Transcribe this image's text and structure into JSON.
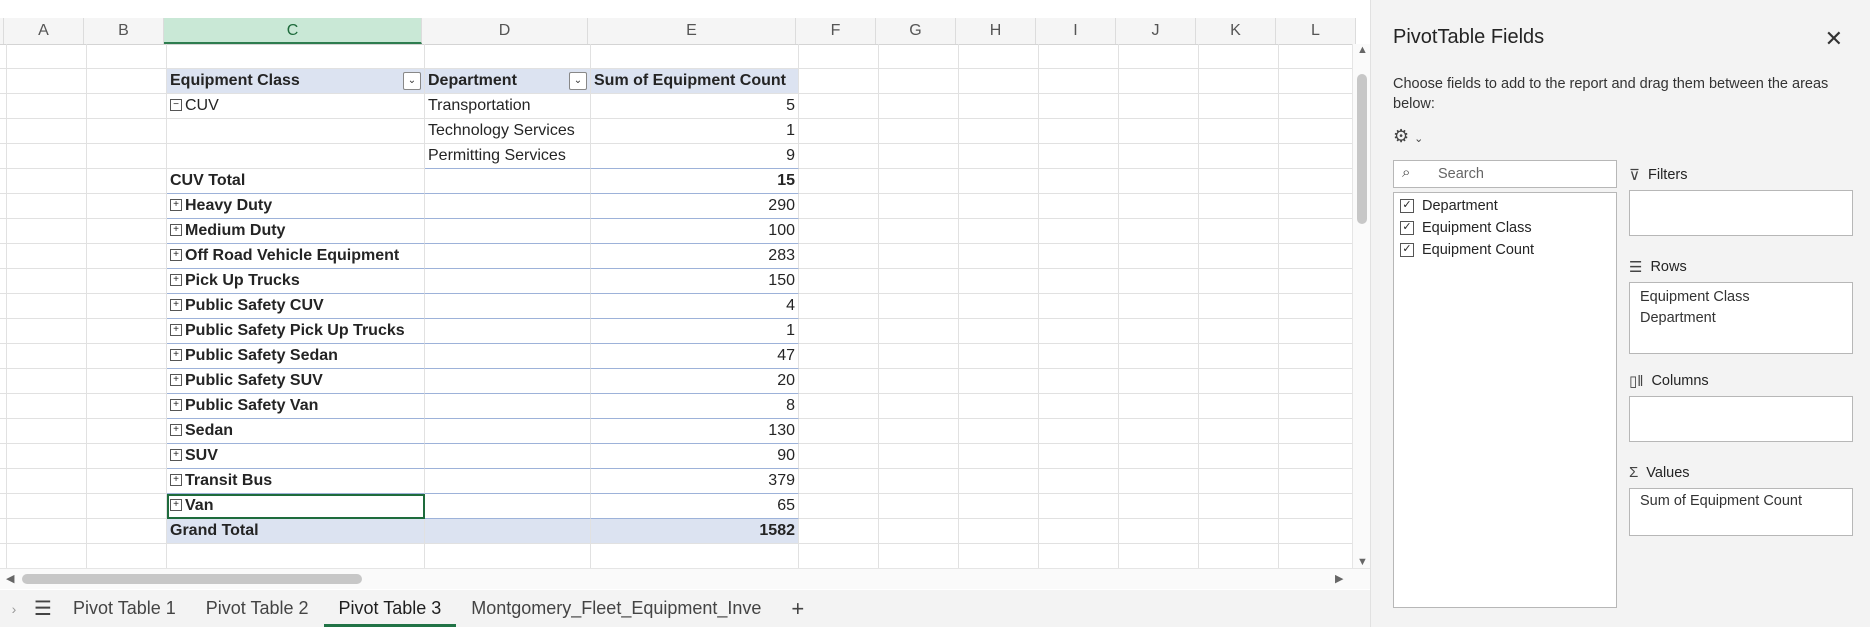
{
  "columns": [
    "A",
    "B",
    "C",
    "D",
    "E",
    "F",
    "G",
    "H",
    "I",
    "J",
    "K",
    "L"
  ],
  "selected_column": "C",
  "pivot": {
    "header": {
      "class": "Equipment Class",
      "dept": "Department",
      "sum": "Sum of Equipment Count"
    },
    "cuv": {
      "label": "CUV",
      "sub": [
        {
          "dept": "Transportation",
          "value": "5"
        },
        {
          "dept": "Technology Services",
          "value": "1"
        },
        {
          "dept": "Permitting Services",
          "value": "9"
        }
      ]
    },
    "cuv_total": {
      "label": "CUV Total",
      "value": "15"
    },
    "groups": [
      {
        "label": "Heavy Duty",
        "value": "290"
      },
      {
        "label": "Medium Duty",
        "value": "100"
      },
      {
        "label": "Off Road Vehicle Equipment",
        "value": "283"
      },
      {
        "label": "Pick Up Trucks",
        "value": "150"
      },
      {
        "label": "Public Safety CUV",
        "value": "4"
      },
      {
        "label": "Public Safety Pick Up Trucks",
        "value": "1"
      },
      {
        "label": "Public Safety Sedan",
        "value": "47"
      },
      {
        "label": "Public Safety SUV",
        "value": "20"
      },
      {
        "label": "Public Safety Van",
        "value": "8"
      },
      {
        "label": "Sedan",
        "value": "130"
      },
      {
        "label": "SUV",
        "value": "90"
      },
      {
        "label": "Transit Bus",
        "value": "379"
      },
      {
        "label": "Van",
        "value": "65"
      }
    ],
    "grand_total": {
      "label": "Grand Total",
      "value": "1582"
    }
  },
  "tabs": [
    "Pivot Table 1",
    "Pivot Table 2",
    "Pivot Table 3",
    "Montgomery_Fleet_Equipment_Inve"
  ],
  "active_tab": "Pivot Table 3",
  "panel": {
    "title": "PivotTable Fields",
    "description": "Choose fields to add to the report and drag them between the areas below:",
    "search_placeholder": "Search",
    "fields": [
      {
        "label": "Department",
        "checked": true
      },
      {
        "label": "Equipment Class",
        "checked": true
      },
      {
        "label": "Equipment Count",
        "checked": true
      }
    ],
    "filters_label": "Filters",
    "rows_label": "Rows",
    "rows_items": [
      "Equipment Class",
      "Department"
    ],
    "columns_label": "Columns",
    "values_label": "Values",
    "values_items": [
      "Sum of Equipment Count"
    ]
  },
  "colors": {
    "accent": "#217346",
    "pivot_header": "#dce3f1",
    "selected_col": "#c9e8d6"
  }
}
